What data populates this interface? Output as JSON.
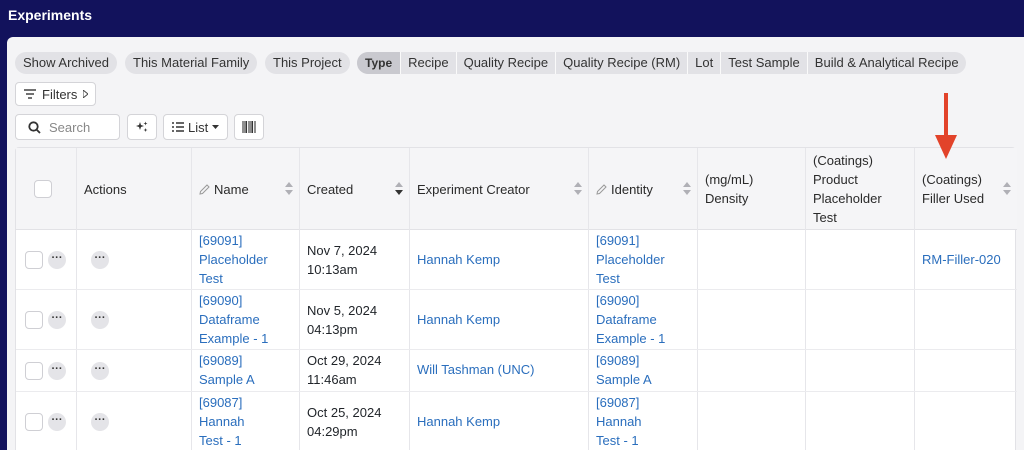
{
  "window": {
    "title": "Experiments"
  },
  "chips": [
    "Show Archived",
    "This Material Family",
    "This Project"
  ],
  "type_filter": {
    "label": "Type",
    "options": [
      "Recipe",
      "Quality Recipe",
      "Quality Recipe (RM)",
      "Lot",
      "Test Sample",
      "Build & Analytical Recipe"
    ]
  },
  "toolbar": {
    "filters_label": "Filters",
    "search_placeholder": "Search",
    "list_label": "List",
    "icons": {
      "filters": "filter-lines-icon",
      "search": "magnifier-icon",
      "magic": "sparkle-icon",
      "list": "list-icon",
      "barcode": "barcode-icon"
    }
  },
  "table": {
    "columns": {
      "actions": "Actions",
      "name": "Name",
      "created": "Created",
      "creator": "Experiment Creator",
      "identity": "Identity",
      "density_1": "(mg/mL)",
      "density_2": "Density",
      "product_1": "(Coatings)",
      "product_2": "Product",
      "product_3": "Placeholder",
      "product_4": "Test",
      "filler_1": "(Coatings)",
      "filler_2": "Filler Used"
    },
    "sort": {
      "column": "Created",
      "direction": "descending"
    },
    "rows": [
      {
        "name": [
          "[69091]",
          "Placeholder",
          "Test"
        ],
        "created": [
          "Nov 7, 2024",
          "10:13am"
        ],
        "creator": "Hannah Kemp",
        "identity": [
          "[69091]",
          "Placeholder",
          "Test"
        ],
        "filler": "RM-Filler-020"
      },
      {
        "name": [
          "[69090]",
          "Dataframe",
          "Example - 1"
        ],
        "created": [
          "Nov 5, 2024",
          "04:13pm"
        ],
        "creator": "Hannah Kemp",
        "identity": [
          "[69090]",
          "Dataframe",
          "Example - 1"
        ],
        "filler": ""
      },
      {
        "name": [
          "[69089]",
          "Sample A"
        ],
        "created": [
          "Oct 29, 2024",
          "11:46am"
        ],
        "creator": "Will Tashman (UNC)",
        "identity": [
          "[69089]",
          "Sample A"
        ],
        "filler": ""
      },
      {
        "name": [
          "[69087]",
          "Hannah",
          "Test - 1"
        ],
        "created": [
          "Oct 25, 2024",
          "04:29pm"
        ],
        "creator": "Hannah Kemp",
        "identity": [
          "[69087]",
          "Hannah",
          "Test - 1"
        ],
        "filler": ""
      }
    ]
  },
  "colors": {
    "header_bg": "#12125c",
    "link": "#2a6ebd",
    "annotation_arrow": "#e2432a"
  }
}
